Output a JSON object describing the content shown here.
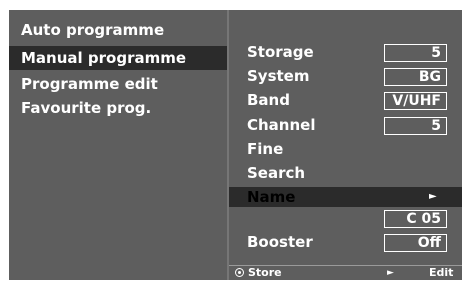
{
  "menu": {
    "items": [
      {
        "label": "Auto programme"
      },
      {
        "label": "Manual programme"
      },
      {
        "label": "Programme edit"
      },
      {
        "label": "Favourite prog."
      }
    ],
    "selected_index": 1
  },
  "settings": {
    "storage": {
      "label": "Storage",
      "value": "5"
    },
    "system": {
      "label": "System",
      "value": "BG"
    },
    "band": {
      "label": "Band",
      "value": "V/UHF"
    },
    "channel": {
      "label": "Channel",
      "value": "5"
    },
    "fine": {
      "label": "Fine"
    },
    "search": {
      "label": "Search"
    },
    "name": {
      "label": "Name",
      "arrow": "►",
      "value": "C 05"
    },
    "booster": {
      "label": "Booster",
      "value": "Off"
    }
  },
  "footer": {
    "store_icon": "record-circle-icon",
    "store_label": "Store",
    "edit_arrow": "►",
    "edit_label": "Edit"
  },
  "colors": {
    "panel": "#5e5e5e",
    "highlight": "#2b2b2b",
    "text": "#ffffff",
    "name_label": "#000000"
  }
}
